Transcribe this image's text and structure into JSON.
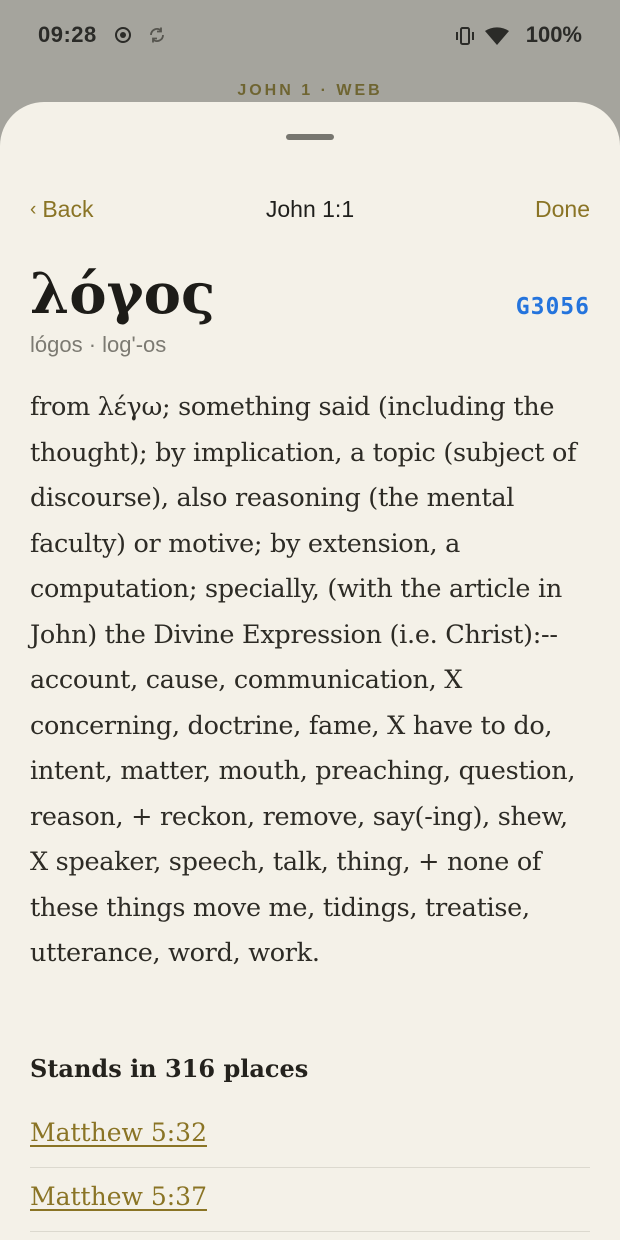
{
  "status_bar": {
    "time": "09:28",
    "battery": "100%",
    "icons": [
      "record-icon",
      "sync-icon",
      "vibrate-icon",
      "wifi-icon"
    ]
  },
  "behind": {
    "header": "JOHN 1 · WEB"
  },
  "nav": {
    "back_label": "Back",
    "back_chevron": "‹",
    "title": "John 1:1",
    "done_label": "Done"
  },
  "entry": {
    "lemma": "λόγος",
    "strongs": "G3056",
    "transliteration": "lógos · log'-os",
    "definition": "from λέγω; something said (including the thought); by implication, a topic (subject of discourse), also reasoning (the mental faculty) or motive; by extension, a computation; specially, (with the article in John) the Divine Expression (i.e. Christ):--account, cause, communication, X concerning, doctrine, fame, X have to do, intent, matter, mouth, preaching, question, reason, + reckon, remove, say(-ing), shew, X speaker, speech, talk, thing, + none of these things move me, tidings, treatise, utterance, word, work."
  },
  "places": {
    "title": "Stands in 316 places",
    "refs": [
      "Matthew 5:32",
      "Matthew 5:37"
    ]
  },
  "colors": {
    "accent": "#8a7425",
    "strongs": "#2474dd",
    "sheet_bg": "#f4f1e8",
    "scrim": "#a5a49d"
  }
}
